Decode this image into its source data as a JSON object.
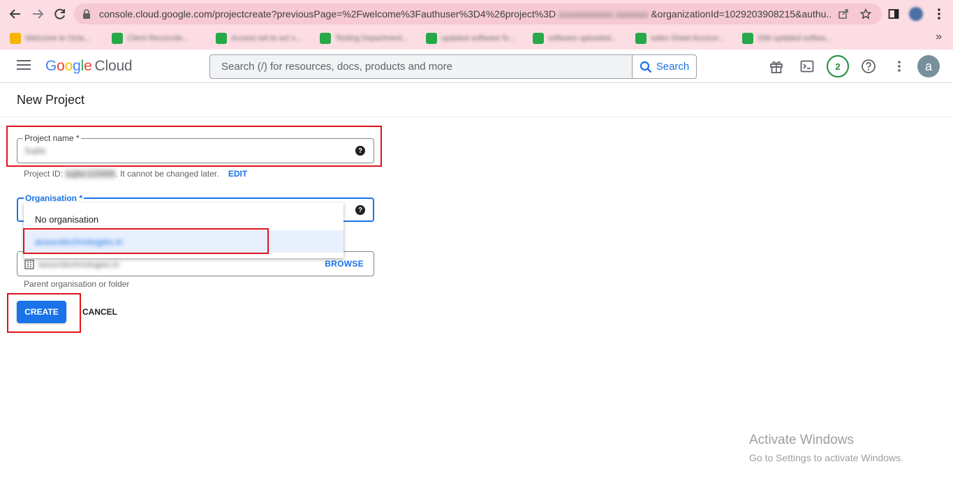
{
  "browser": {
    "url": "console.cloud.google.com/projectcreate?previousPage=%2Fwelcome%3Fauthuser%3D4%26project%3D",
    "url_tail": "&organizationId=1029203908215&authu...",
    "bookmarks": [
      "Welcome to Octa...",
      "Client Reconcile...",
      "Access set to act s...",
      "Testing Department...",
      "updated software fo...",
      "software uploaded...",
      "sales Sheet Accoun...",
      "SIM updated softwa..."
    ],
    "bookmarks_more": "»"
  },
  "header": {
    "logo_letters": [
      "G",
      "o",
      "o",
      "g",
      "l",
      "e"
    ],
    "logo_cloud": "Cloud",
    "search_placeholder": "Search (/) for resources, docs, products and more",
    "search_button": "Search",
    "notification_count": "2",
    "avatar_letter": "a",
    "icons": [
      "gift-icon",
      "cloud-shell-icon",
      "help-icon",
      "more-vert-icon"
    ]
  },
  "page": {
    "title": "New Project",
    "project_name_label": "Project name *",
    "project_name_value": "Sujita",
    "project_id_prefix": "Project ID:",
    "project_id_value": "sujita-123456",
    "project_id_suffix": ". It cannot be changed later.",
    "edit_label": "EDIT",
    "organisation_label": "Organisation *",
    "org_options": [
      "No organisation",
      "assurotechnologies.in"
    ],
    "location_value": "assurotechnologies.in",
    "browse_label": "BROWSE",
    "location_hint": "Parent organisation or folder",
    "create_label": "CREATE",
    "cancel_label": "CANCEL"
  },
  "watermark": {
    "line1": "Activate Windows",
    "line2": "Go to Settings to activate Windows."
  }
}
